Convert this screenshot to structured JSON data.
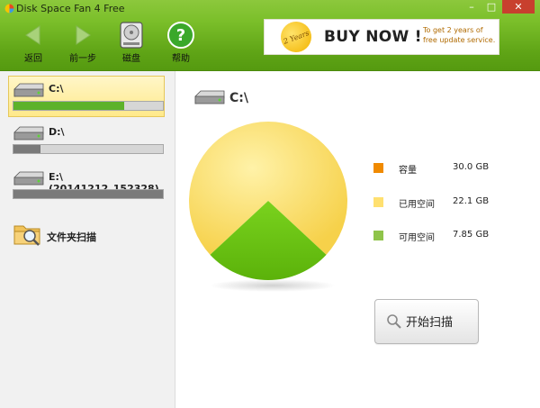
{
  "window": {
    "title": "Disk Space Fan 4 Free",
    "controls": {
      "minimize": "–",
      "maximize": "□",
      "close": "✕"
    }
  },
  "toolbar": {
    "back_label": "返回",
    "forward_label": "前一步",
    "disk_label": "磁盘",
    "help_label": "帮助"
  },
  "banner": {
    "badge_text": "2 Years",
    "buy_text": "BUY NOW !",
    "promo_line1": "To get  2  years of",
    "promo_line2": "free update service."
  },
  "sidebar": {
    "drives": [
      {
        "name": "C:\\",
        "used_fraction": 0.74,
        "bar_color": "#5db22a",
        "selected": true
      },
      {
        "name": "D:\\",
        "used_fraction": 0.18,
        "bar_color": "#7a7a7a",
        "selected": false
      },
      {
        "name": "E:\\(20141212_152328)",
        "used_fraction": 1.0,
        "bar_color": "#7a7a7a",
        "selected": false
      }
    ],
    "folder_scan_label": "文件夹扫描"
  },
  "main": {
    "drive_title": "C:\\",
    "legend": [
      {
        "label": "容量",
        "value": "30.0 GB",
        "color": "#f08a00"
      },
      {
        "label": "已用空间",
        "value": "22.1 GB",
        "color": "#ffe070"
      },
      {
        "label": "可用空间",
        "value": "7.85 GB",
        "color": "#8fc44a"
      }
    ],
    "scan_button_label": "开始扫描"
  },
  "chart_data": {
    "type": "pie",
    "categories": [
      "已用空间",
      "可用空间"
    ],
    "values": [
      22.1,
      7.85
    ],
    "colors": [
      "#ffe070",
      "#6fc418"
    ]
  }
}
